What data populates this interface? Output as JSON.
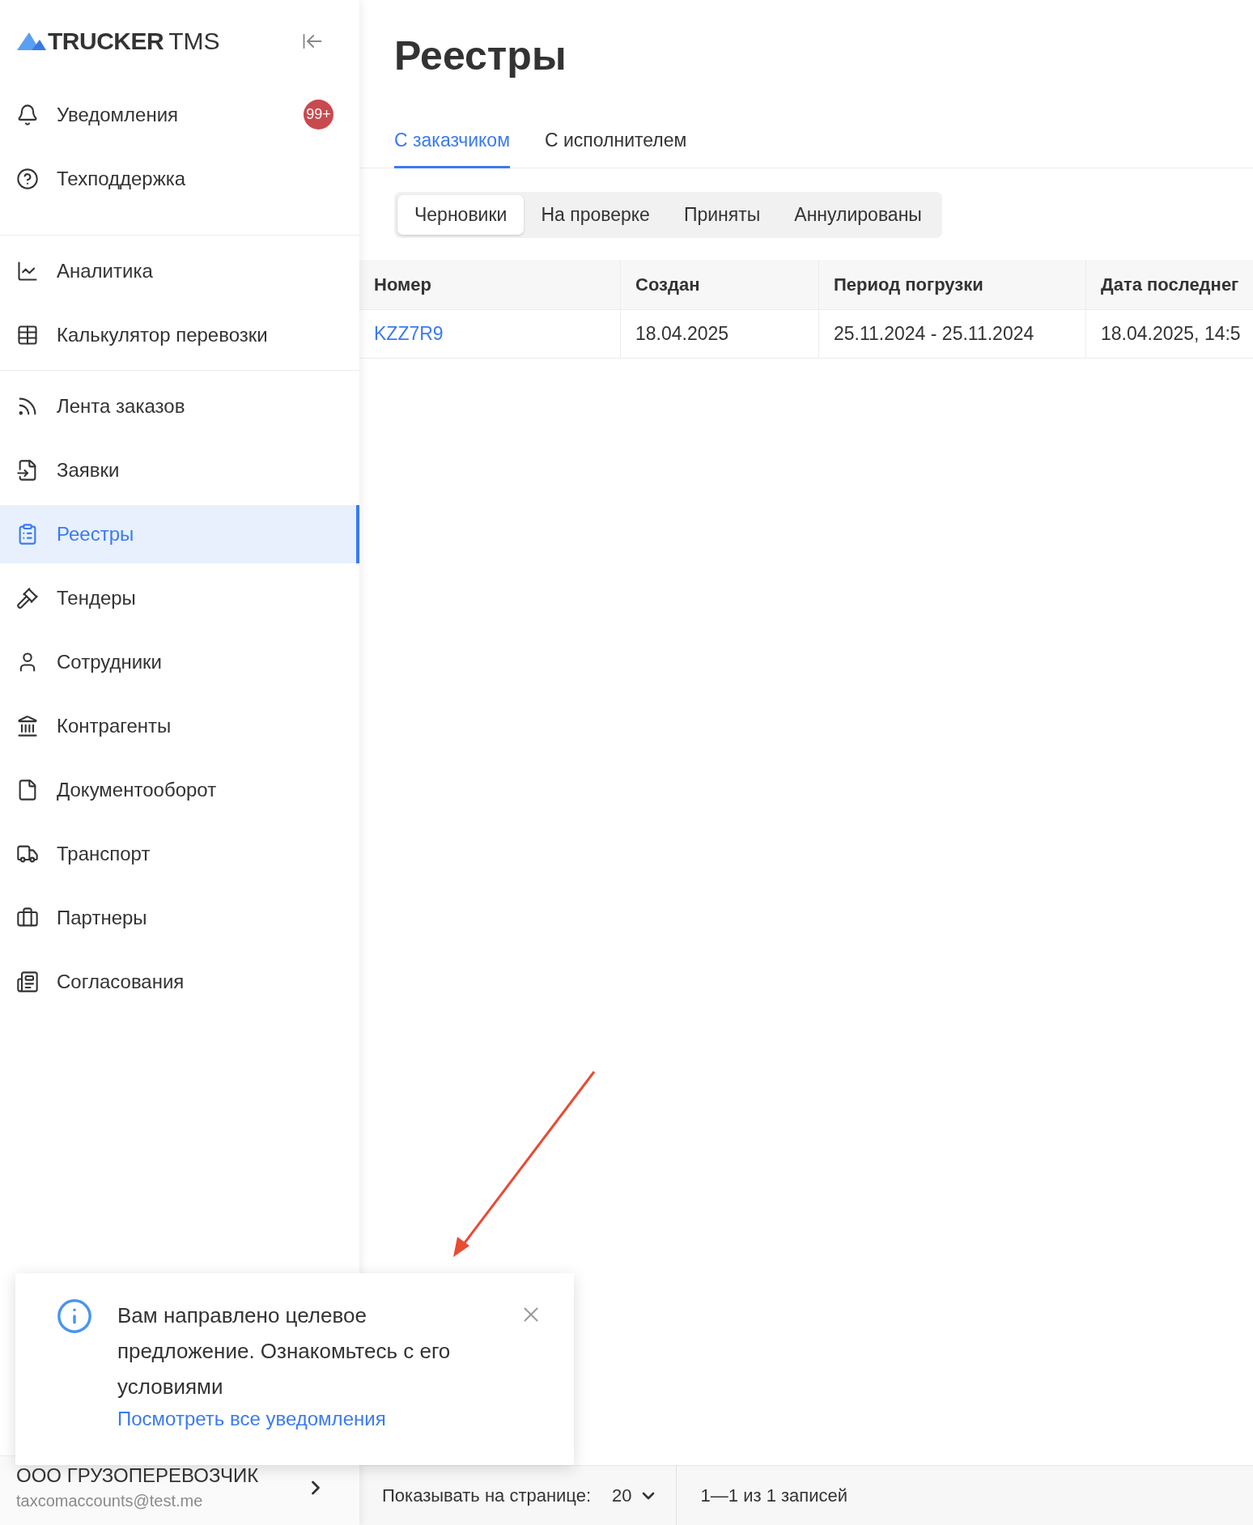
{
  "logo": {
    "name": "TRUCKER",
    "suffix": "TMS"
  },
  "sidebar": {
    "groups": [
      {
        "items": [
          {
            "label": "Уведомления",
            "selected": false,
            "badge": "99+"
          },
          {
            "label": "Техподдержка",
            "selected": false
          }
        ]
      },
      {
        "items": [
          {
            "label": "Аналитика",
            "selected": false
          },
          {
            "label": "Калькулятор перевозки",
            "selected": false
          }
        ]
      },
      {
        "items": [
          {
            "label": "Лента заказов",
            "selected": false
          },
          {
            "label": "Заявки",
            "selected": false
          },
          {
            "label": "Реестры",
            "selected": true
          },
          {
            "label": "Тендеры",
            "selected": false
          },
          {
            "label": "Сотрудники",
            "selected": false
          },
          {
            "label": "Контрагенты",
            "selected": false
          },
          {
            "label": "Документооборот",
            "selected": false
          },
          {
            "label": "Транспорт",
            "selected": false
          },
          {
            "label": "Партнеры",
            "selected": false
          },
          {
            "label": "Согласования",
            "selected": false
          }
        ]
      }
    ],
    "account": {
      "company": "ООО ГРУЗОПЕРЕВОЗЧИК",
      "email": "taxcomaccounts@test.me"
    }
  },
  "page": {
    "title": "Реестры"
  },
  "tabs": [
    {
      "label": "С заказчиком",
      "selected": true
    },
    {
      "label": "С исполнителем",
      "selected": false
    }
  ],
  "segments": [
    {
      "label": "Черновики",
      "selected": true
    },
    {
      "label": "На проверке",
      "selected": false
    },
    {
      "label": "Приняты",
      "selected": false
    },
    {
      "label": "Аннулированы",
      "selected": false
    }
  ],
  "table": {
    "columns": [
      "Номер",
      "Создан",
      "Период погрузки",
      "Дата последнег"
    ],
    "rows": [
      {
        "cells": [
          "KZZ7R9",
          "18.04.2025",
          "25.11.2024 - 25.11.2024",
          "18.04.2025, 14:5"
        ]
      }
    ]
  },
  "notification": {
    "message": "Вам направлено целевое предложение. Ознакомьтесь с его условиями",
    "link": "Посмотреть все уведомления"
  },
  "footer": {
    "page_size_label": "Показывать на странице:",
    "page_size": "20",
    "range": "1—1 из 1 записей"
  }
}
